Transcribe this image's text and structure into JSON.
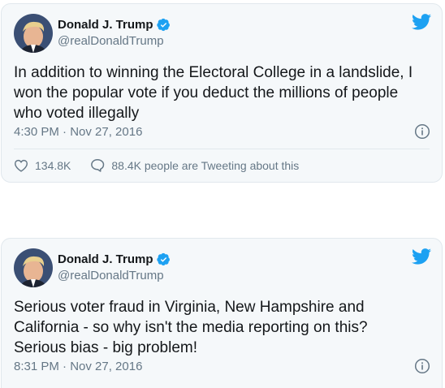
{
  "tweets": [
    {
      "name": "Donald J. Trump",
      "handle": "@realDonaldTrump",
      "text": "In addition to winning the Electoral College in a landslide, I won the popular vote if you deduct the millions of people who voted illegally",
      "timestamp": "4:30 PM · Nov 27, 2016",
      "likes": "134.8K",
      "tweeting": "88.4K people are Tweeting about this"
    },
    {
      "name": "Donald J. Trump",
      "handle": "@realDonaldTrump",
      "text": "Serious voter fraud in Virginia, New Hampshire and California - so why isn't the media reporting on this? Serious bias - big problem!",
      "timestamp": "8:31 PM · Nov 27, 2016"
    }
  ],
  "colors": {
    "twitter_blue": "#1da1f2",
    "secondary_text": "#657786",
    "card_background": "#f5f8fa",
    "border": "#e1e8ed"
  },
  "icons": [
    "twitter-bird-icon",
    "verified-badge-icon",
    "info-icon",
    "heart-icon",
    "speech-bubble-icon"
  ]
}
